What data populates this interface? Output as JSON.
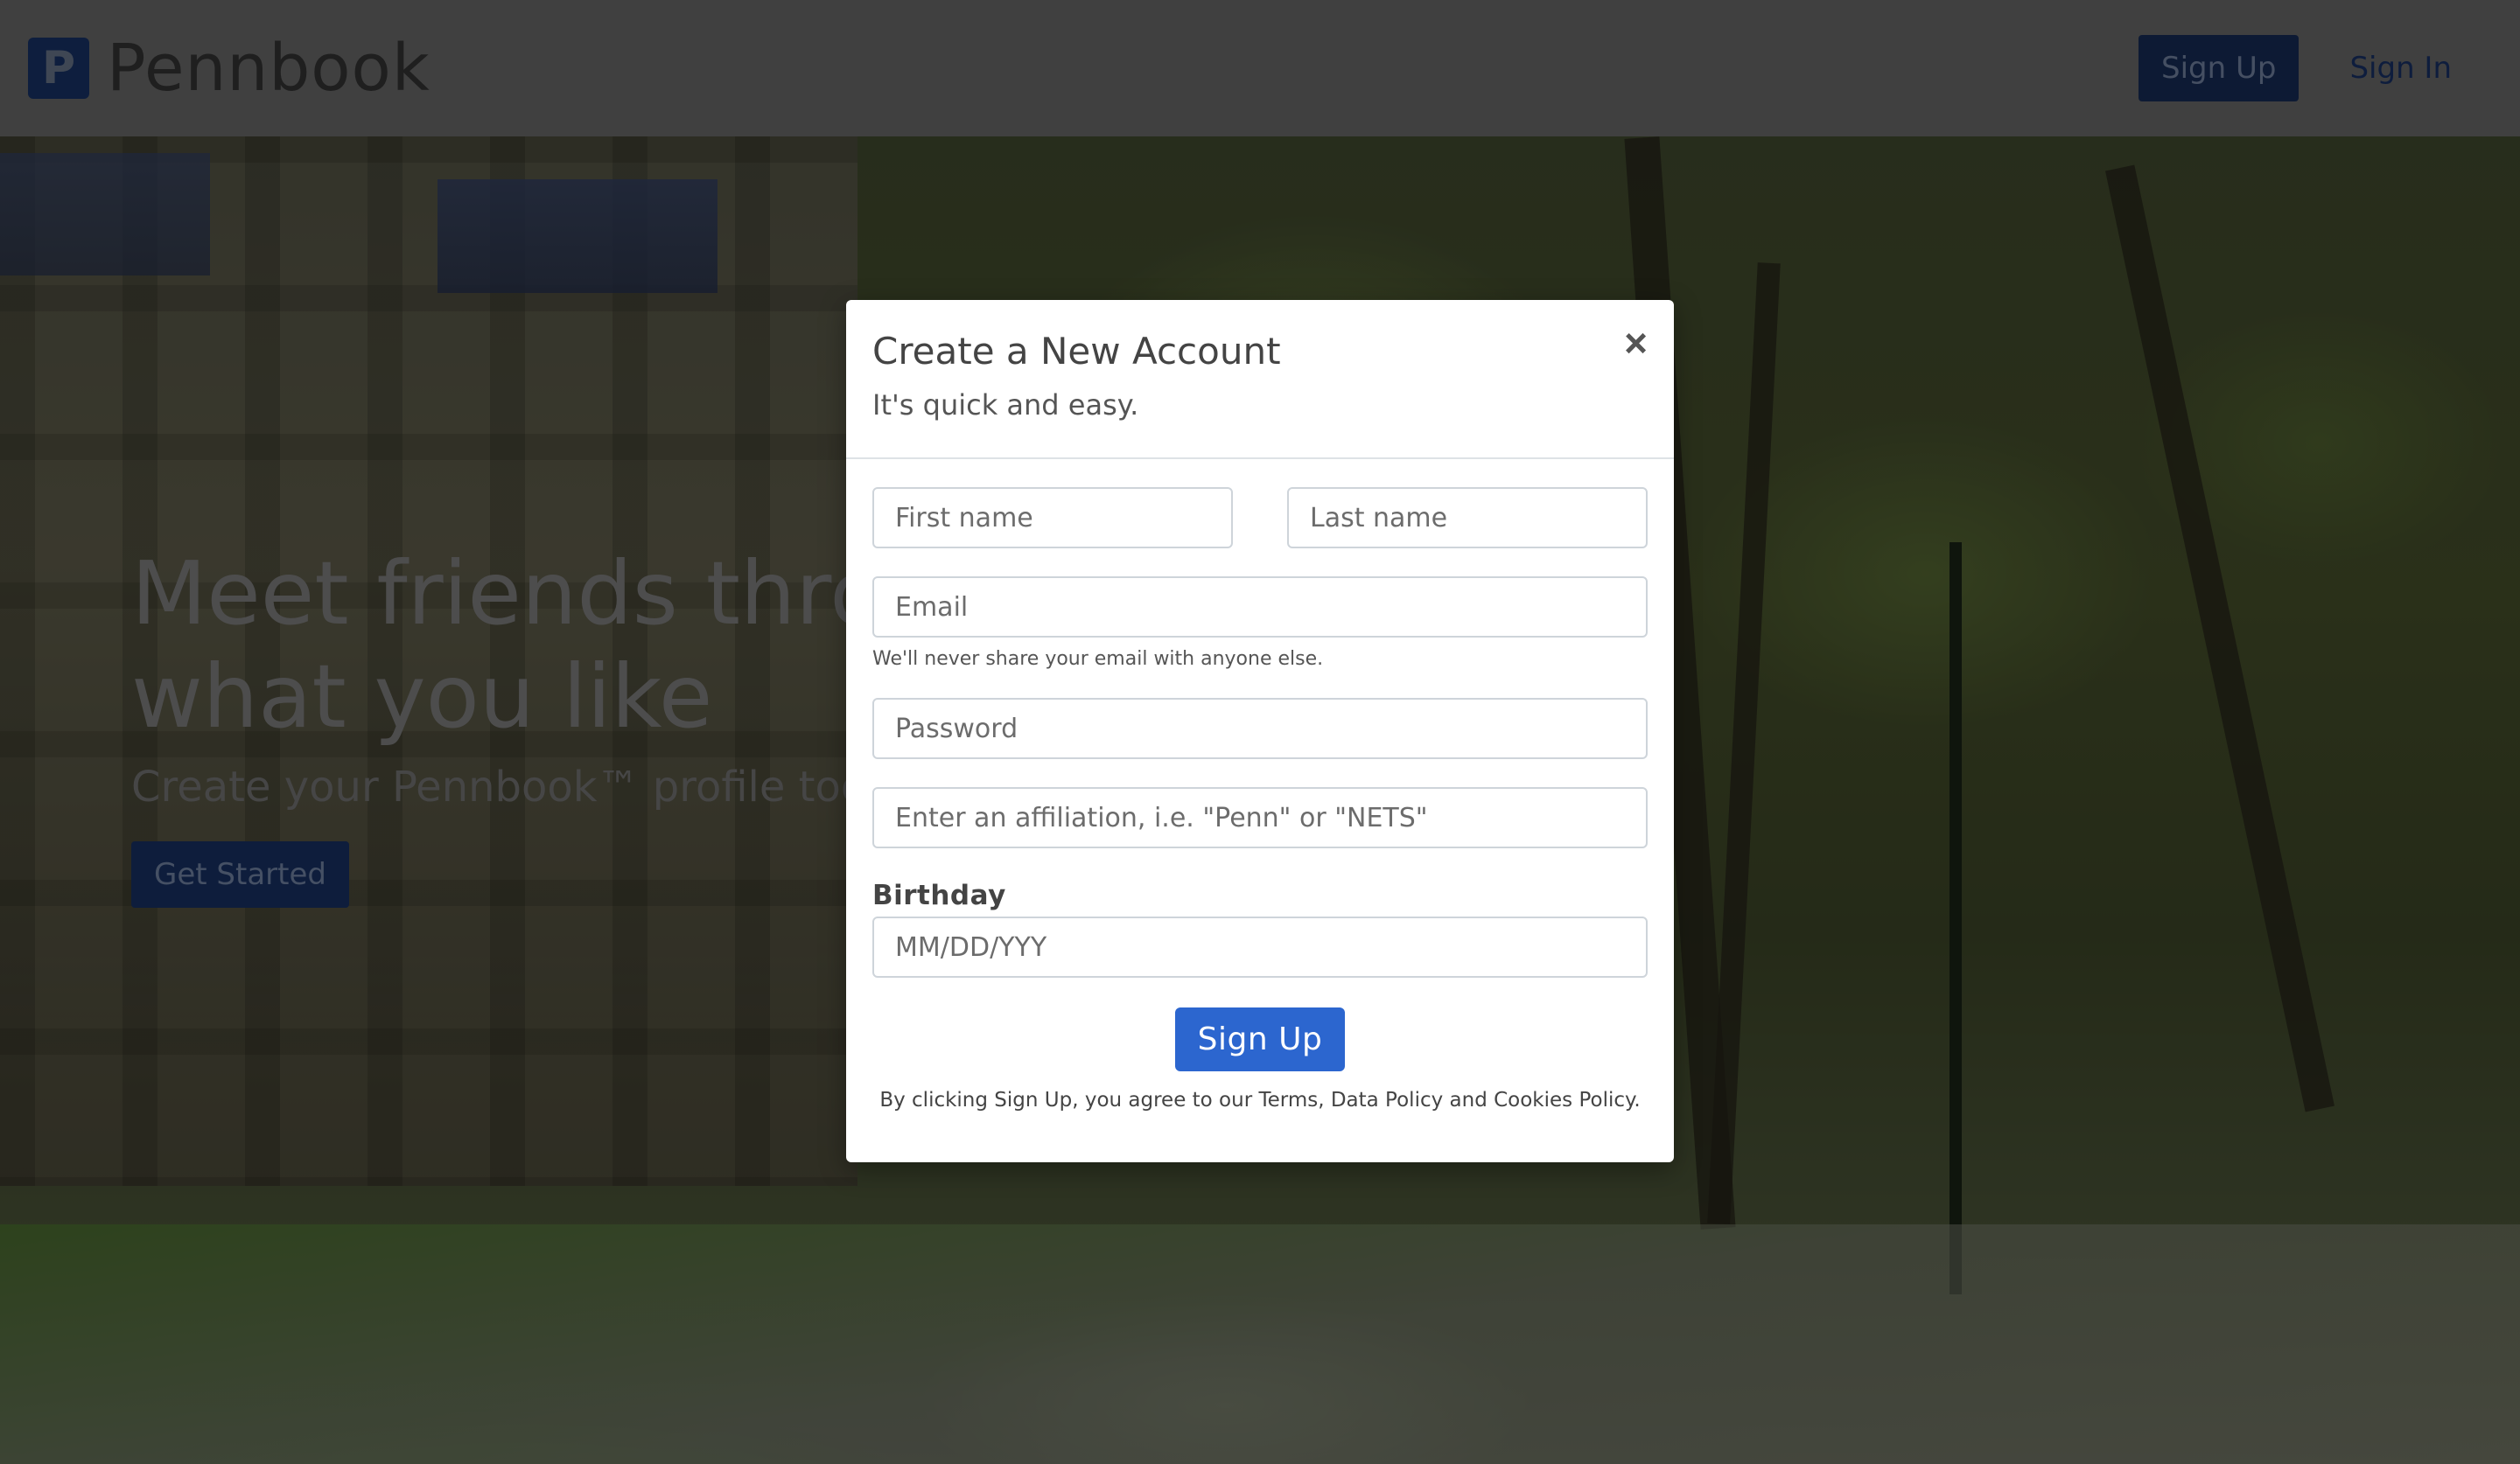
{
  "nav": {
    "logo_letter": "P",
    "brand": "Pennbook",
    "signup_label": "Sign Up",
    "signin_label": "Sign In"
  },
  "hero": {
    "headline": "Meet friends through\nwhat you like",
    "subheading": "Create your Pennbook™ profile today",
    "cta_label": "Get Started"
  },
  "modal": {
    "title": "Create a New Account",
    "subtitle": "It's quick and easy.",
    "close_symbol": "×",
    "first_name_placeholder": "First name",
    "last_name_placeholder": "Last name",
    "email_placeholder": "Email",
    "email_help": "We'll never share your email with anyone else.",
    "password_placeholder": "Password",
    "affiliation_placeholder": "Enter an affiliation, i.e. \"Penn\" or \"NETS\"",
    "birthday_label": "Birthday",
    "birthday_placeholder": "MM/DD/YYY",
    "submit_label": "Sign Up",
    "terms": "By clicking Sign Up, you agree to our Terms, Data Policy and Cookies Policy."
  },
  "colors": {
    "brand_blue": "#1d3d7c",
    "submit_blue": "#2c66cf",
    "overlay": "rgba(0,0,0,0.5)"
  },
  "icons": {
    "close": "close-icon",
    "logo": "pennbook-logo-icon"
  }
}
